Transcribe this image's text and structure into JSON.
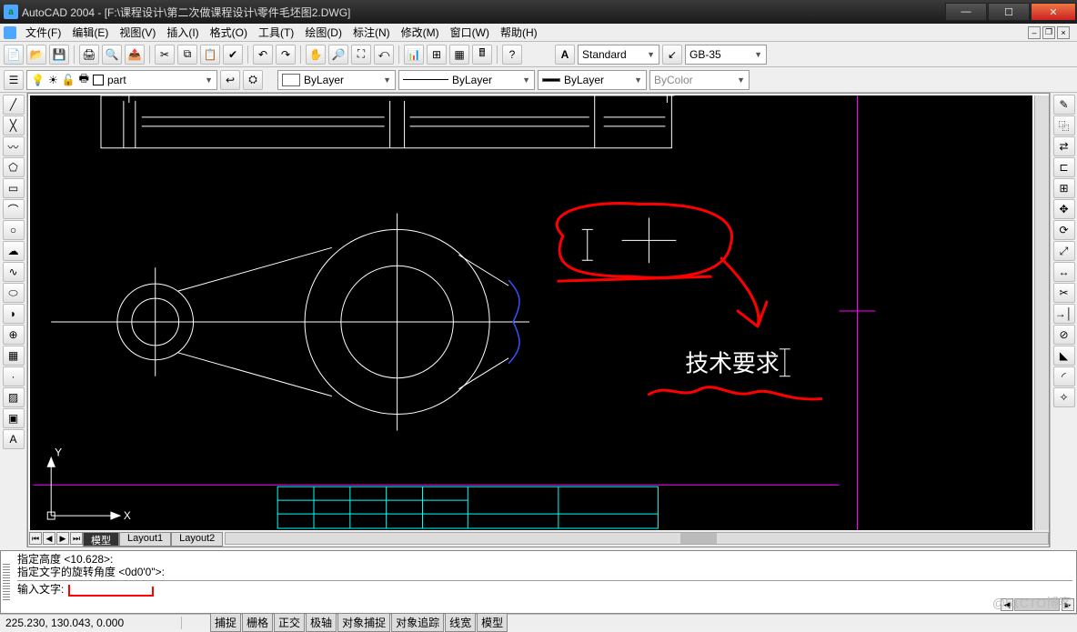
{
  "title": "AutoCAD 2004 - [F:\\课程设计\\第二次做课程设计\\零件毛坯图2.DWG]",
  "menus": {
    "file": "文件(F)",
    "edit": "编辑(E)",
    "view": "视图(V)",
    "insert": "插入(I)",
    "format": "格式(O)",
    "tools": "工具(T)",
    "draw": "绘图(D)",
    "dim": "标注(N)",
    "modify": "修改(M)",
    "window": "窗口(W)",
    "help": "帮助(H)"
  },
  "textstyle_label": "A",
  "textstyle": "Standard",
  "dimstyle": "GB-35",
  "layer": "part",
  "linetype_label": "ByLayer",
  "lineweight_label": "ByLayer",
  "color_label": "ByLayer",
  "plotstyle": "ByColor",
  "tabs": {
    "model": "模型",
    "l1": "Layout1",
    "l2": "Layout2"
  },
  "cmd": {
    "l1": "指定高度 <10.628>:",
    "l2": "指定文字的旋转角度 <0d0'0\">:",
    "l3": "输入文字:"
  },
  "status": {
    "coord": "225.230, 130.043, 0.000",
    "snap": "捕捉",
    "grid": "栅格",
    "ortho": "正交",
    "polar": "极轴",
    "osnap": "对象捕捉",
    "otrack": "对象追踪",
    "lwt": "线宽",
    "model": "模型"
  },
  "drawing_text": "技术要求",
  "ucs": {
    "x": "X",
    "y": "Y"
  },
  "watermark": "@51CTO博客",
  "colors": {
    "accent": "#2a7fff",
    "markup": "#ff0000",
    "cyan": "#00ffff",
    "magenta": "#ff00ff",
    "blue": "#3344ff",
    "white": "#ffffff",
    "yellow": "#ffff00"
  }
}
